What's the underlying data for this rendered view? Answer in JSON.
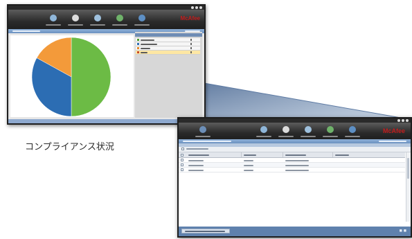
{
  "caption": "コンプライアンス状況",
  "overview_window": {
    "brand": "McAfee",
    "compliance_chart": {
      "colors": [
        "#6cbb45",
        "#2c6db3",
        "#f39a3a"
      ],
      "legend_colors": [
        "#4c9b2c",
        "#2c6db3",
        "#e5882a",
        "#c94a2a"
      ]
    }
  },
  "detail_window": {
    "brand": "McAfee",
    "row_count": 3
  },
  "chart_data": {
    "type": "pie",
    "title": "",
    "labels": [],
    "values": [
      50,
      33,
      17
    ],
    "colors": [
      "#6cbb45",
      "#2c6db3",
      "#f39a3a"
    ]
  }
}
